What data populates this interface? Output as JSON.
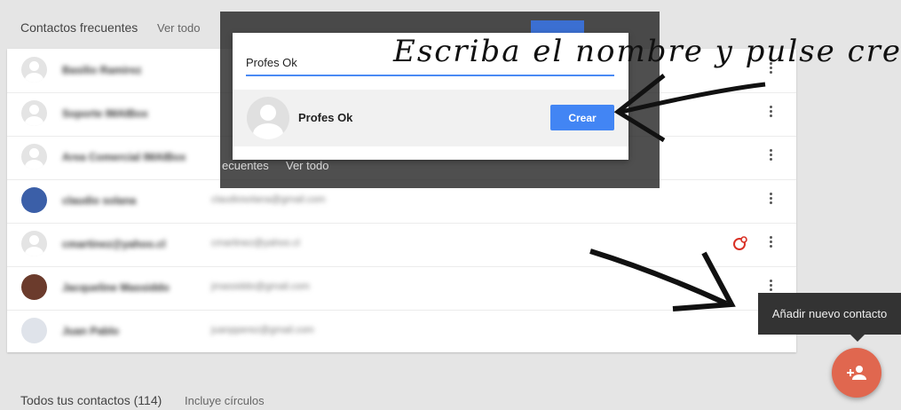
{
  "frequent": {
    "title": "Contactos frecuentes",
    "link": "Ver todo"
  },
  "contacts": [
    {
      "name": "Basilio Ramirez",
      "email": "",
      "avatar": "generic"
    },
    {
      "name": "Soporte IMAIBox",
      "email": "",
      "avatar": "generic"
    },
    {
      "name": "Area Comercial IMAIBox",
      "email": "",
      "avatar": "generic"
    },
    {
      "name": "claudio solana",
      "email": "claudiosolana@gmail.com",
      "avatar": "#3b5fa8"
    },
    {
      "name": "cmartinez@yahoo.cl",
      "email": "cmartinez@yahoo.cl",
      "avatar": "generic"
    },
    {
      "name": "Jacqueline Massiddo",
      "email": "jmassiddo@gmail.com",
      "avatar": "#6b3b2c"
    },
    {
      "name": "Juan Pablo",
      "email": "juanpperez@gmail.com",
      "avatar": "#dfe3ea"
    }
  ],
  "all_contacts": {
    "title": "Todos tus contactos (114)",
    "subtitle": "Incluye círculos"
  },
  "dialog": {
    "input_value": "Profes Ok",
    "suggestion_name": "Profes Ok",
    "create_label": "Crear",
    "underlay_text_1": "ecuentes",
    "underlay_text_2": "Ver todo"
  },
  "annotation": "Escriba el nombre y pulse crear",
  "tooltip": "Añadir nuevo contacto",
  "colors": {
    "accent": "#4285f4",
    "fab": "#e0674f",
    "circle_icon": "#d93025"
  },
  "icons": {
    "more": "more-vert-icon",
    "fab": "person-add-icon",
    "circle": "circle-icon"
  }
}
